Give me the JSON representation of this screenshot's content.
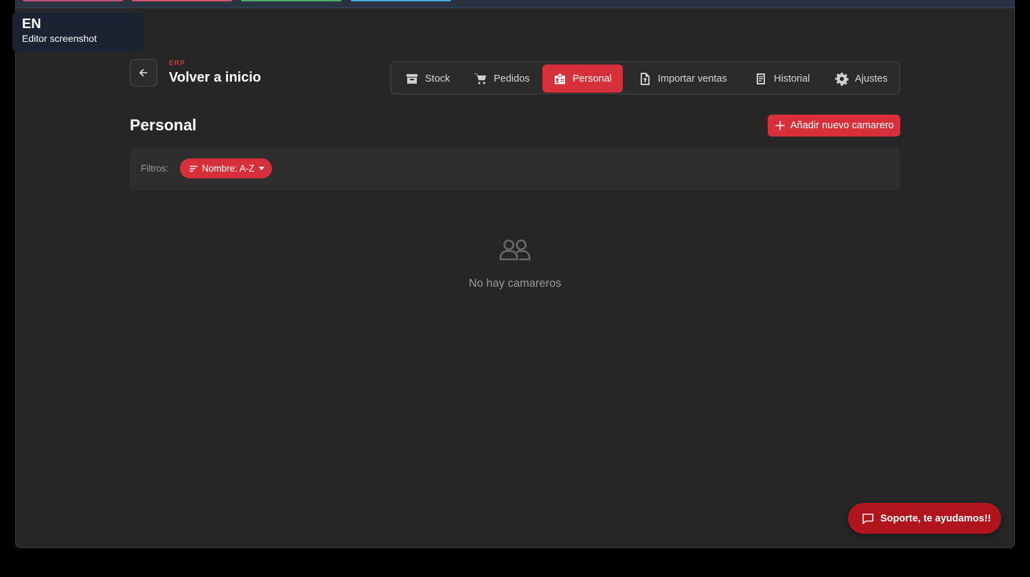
{
  "badge": {
    "lang": "EN",
    "subtitle": "Editor screenshot"
  },
  "header": {
    "section": "ERP",
    "back_label": "Volver a inicio"
  },
  "nav": {
    "items": [
      {
        "label": "Stock",
        "icon": "archive-box-icon"
      },
      {
        "label": "Pedidos",
        "icon": "shopping-cart-icon"
      },
      {
        "label": "Personal",
        "icon": "id-badge-icon",
        "active": true
      },
      {
        "label": "Importar ventas",
        "icon": "file-upload-icon"
      },
      {
        "label": "Historial",
        "icon": "receipt-icon"
      },
      {
        "label": "Ajustes",
        "icon": "gear-icon"
      }
    ]
  },
  "page": {
    "title": "Personal",
    "add_button": "Añadir nuevo camarero"
  },
  "filters": {
    "label": "Filtros:",
    "sort_chip": "Nombre: A-Z"
  },
  "empty": {
    "message": "No hay camareros"
  },
  "support": {
    "label": "Soporte, te ayudamos!!"
  },
  "colors": {
    "accent": "#d7303b",
    "support_bg": "#b0141c",
    "background": "#262626"
  },
  "top_tab_colors": [
    "#c84d7e",
    "#d6556a",
    "#4caf68",
    "#4aa8d8"
  ]
}
